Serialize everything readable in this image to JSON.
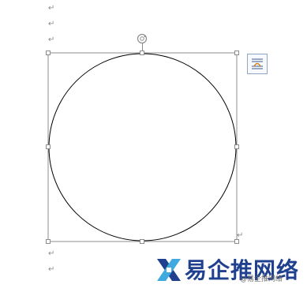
{
  "document": {
    "paragraph_mark": "↵"
  },
  "shape": {
    "type": "circle",
    "selected": true,
    "rotate_handle": "rotate-handle",
    "resize_handles": [
      "top-left",
      "top",
      "top-right",
      "left",
      "right",
      "bottom-left",
      "bottom",
      "bottom-right"
    ]
  },
  "layout_options": {
    "icon": "layout-options-icon"
  },
  "watermark": {
    "text": "易企推网络",
    "sub_text": "@易企推网络"
  },
  "colors": {
    "selection_border": "#8c8c8c",
    "shape_stroke": "#000000",
    "handle_fill": "#ffffff",
    "watermark_blue": "#1f3f8f",
    "watermark_light_blue": "#3fa9e0"
  }
}
